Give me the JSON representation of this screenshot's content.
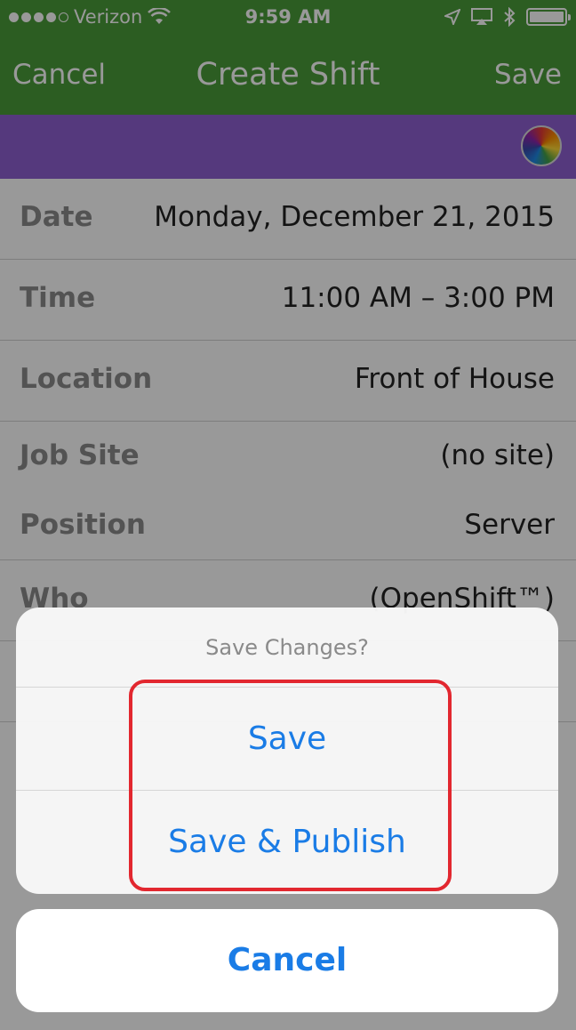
{
  "status_bar": {
    "carrier": "Verizon",
    "time": "9:59 AM"
  },
  "nav": {
    "cancel_label": "Cancel",
    "title": "Create Shift",
    "save_label": "Save"
  },
  "theme": {
    "nav_color": "#4a9b3a",
    "strip_color": "#8e5fd0",
    "accent_blue": "#1a7ce6",
    "highlight_red": "#e2272f"
  },
  "form": {
    "rows": [
      {
        "label": "Date",
        "value": "Monday, December 21, 2015"
      },
      {
        "label": "Time",
        "value": "11:00 AM – 3:00 PM"
      },
      {
        "label": "Location",
        "value": "Front of House"
      },
      {
        "label": "Job Site",
        "value": "(no site)"
      },
      {
        "label": "Position",
        "value": "Server"
      },
      {
        "label": "Who",
        "value": "(OpenShift™)"
      }
    ]
  },
  "action_sheet": {
    "title": "Save Changes?",
    "save_label": "Save",
    "save_publish_label": "Save & Publish",
    "cancel_label": "Cancel"
  }
}
